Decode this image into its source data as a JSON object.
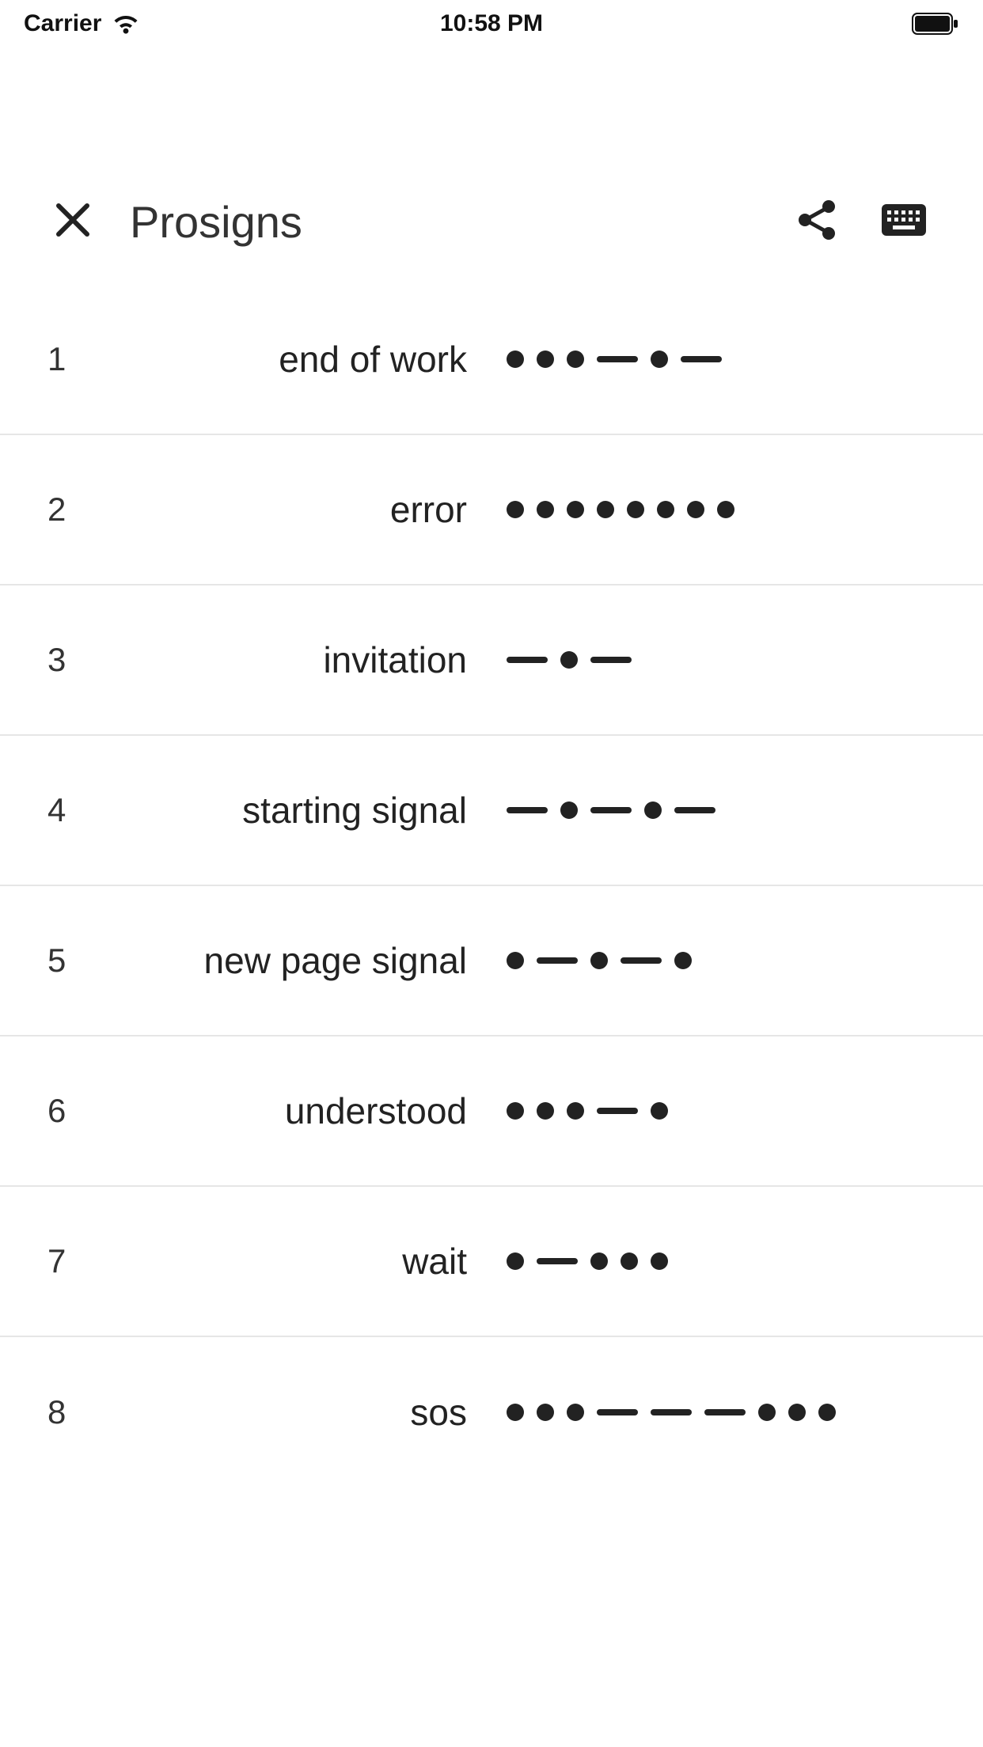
{
  "status_bar": {
    "carrier": "Carrier",
    "time": "10:58 PM"
  },
  "header": {
    "title": "Prosigns"
  },
  "rows": [
    {
      "num": "1",
      "label": "end of work",
      "morse": "... - . -"
    },
    {
      "num": "2",
      "label": "error",
      "morse": "........"
    },
    {
      "num": "3",
      "label": "invitation",
      "morse": "- . -"
    },
    {
      "num": "4",
      "label": "starting signal",
      "morse": "- . - . -"
    },
    {
      "num": "5",
      "label": "new page signal",
      "morse": ". - . - ."
    },
    {
      "num": "6",
      "label": "understood",
      "morse": "... - ."
    },
    {
      "num": "7",
      "label": "wait",
      "morse": ". - ..."
    },
    {
      "num": "8",
      "label": "sos",
      "morse": "... - - - ..."
    }
  ]
}
